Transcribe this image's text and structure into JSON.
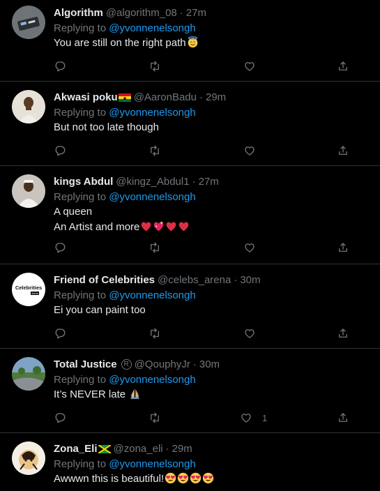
{
  "reply_prefix": "Replying to",
  "tweets": [
    {
      "name": "Algorithm",
      "handle": "@algorithm_08",
      "time": "27m",
      "mention": "@yvonnenelsongh",
      "lines": [
        "You are still on the right path"
      ],
      "like_count": ""
    },
    {
      "name": "Akwasi poku",
      "handle": "@AaronBadu",
      "time": "29m",
      "mention": "@yvonnenelsongh",
      "lines": [
        "But not too late though"
      ],
      "like_count": ""
    },
    {
      "name": "kings Abdul",
      "handle": "@kingz_Abdul1",
      "time": "27m",
      "mention": "@yvonnenelsongh",
      "lines": [
        "A queen",
        "An Artist and more"
      ],
      "like_count": ""
    },
    {
      "name": "Friend of Celebrities",
      "handle": "@celebs_arena",
      "time": "30m",
      "mention": "@yvonnenelsongh",
      "lines": [
        "Ei you can paint too"
      ],
      "like_count": ""
    },
    {
      "name": "Total Justice",
      "handle": "@QouphyJr",
      "time": "30m",
      "mention": "@yvonnenelsongh",
      "lines": [
        "It’s NEVER late"
      ],
      "like_count": "1"
    },
    {
      "name": "Zona_Eli",
      "handle": "@zona_eli",
      "time": "29m",
      "mention": "@yvonnenelsongh",
      "lines": [
        "Awwwn this is beautiful!"
      ],
      "like_count": ""
    }
  ],
  "icons": {
    "reply": "reply-icon",
    "retweet": "retweet-icon",
    "like": "like-icon",
    "share": "share-icon"
  },
  "colors": {
    "background": "#000000",
    "mention": "#1d9bf0",
    "muted": "#71767b",
    "divider": "#2f3336"
  }
}
